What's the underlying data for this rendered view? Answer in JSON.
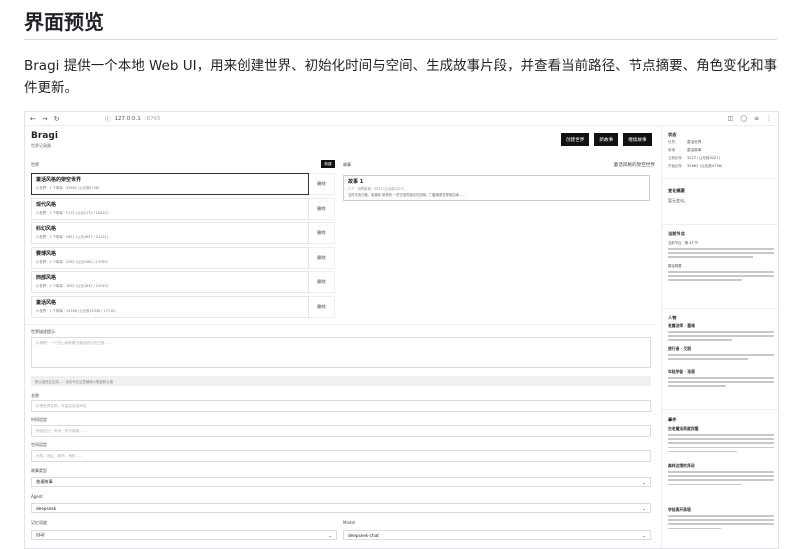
{
  "doc": {
    "title": "界面预览",
    "paragraph": "Bragi 提供一个本地 Web UI，用来创建世界、初始化时间与空间、生成故事片段，并查看当前路径、节点摘要、角色变化和事件更新。"
  },
  "browser": {
    "url": "127.0.0.1",
    "port": ":8765",
    "nav": [
      "←",
      "→",
      "↻"
    ],
    "right_icons": [
      "◫",
      "◯",
      "≡",
      "⋮"
    ]
  },
  "app": {
    "title": "Bragi",
    "subtitle": "世界记录器",
    "buttons": [
      "创建世界",
      "新故事",
      "继续故事"
    ]
  },
  "worlds": {
    "label": "世界",
    "new_label": "新建",
    "delete_label": "删除",
    "items": [
      {
        "name": "童话风格的架空世界",
        "meta": "小世界 · 1 个故事 · 32662 (公元前4756)"
      },
      {
        "name": "现代风格",
        "meta": "小世界 · 1 个故事 · 2172 (公元2172 / 18220)"
      },
      {
        "name": "科幻风格",
        "meta": "小世界 · 1 个故事 · 2657 (公元2657 / 24122)"
      },
      {
        "name": "赛博风格",
        "meta": "小世界 · 1 个故事 · 2062 (公元2062 / 13759)"
      },
      {
        "name": "西部风格",
        "meta": "小世界 · 1 个故事 · 1832 (公元1832 / 24743)"
      },
      {
        "name": "童话风格",
        "meta": "小世界 · 1 个故事 · 15336 (公元前15336 / 17710)"
      }
    ]
  },
  "story": {
    "label": "故事",
    "world_name": "童话风格的架空世界",
    "card_title": "故事 1",
    "card_meta": "1 个 · 世界故事 · 3227 (公元前3227)",
    "card_text": "当时天色已晚，老森林 常常有 一些古老的魔法在回响。门槛像是在呼吸边缘……"
  },
  "form": {
    "prompt_label": "世界描述提示",
    "prompt_placeholder": "示例提：一个在山间有着与魔法成长的王国……",
    "note": "默认描述会生成……设定可在这里编辑以覆盖默认值",
    "name_label": "名称",
    "name_placeholder": "示例世界名称，可留空自动命名",
    "time_label": "时间设定",
    "time_placeholder": "例如纪元、年份、时代背景……",
    "space_label": "空间设定",
    "space_placeholder": "大陆、地区、城市、地形……",
    "genre_label": "故事类型",
    "genre_value": "普通故事",
    "agent_label": "Agent",
    "agent_value": "deepseek",
    "memory_label": "记忆深度",
    "memory_value": "自动",
    "model_label": "Model",
    "model_value": "deepseek-chat"
  },
  "side": {
    "status_title": "状态",
    "status": [
      {
        "k": "世界",
        "v": "童话世界"
      },
      {
        "k": "故事",
        "v": "童话故事"
      },
      {
        "k": "当前纪年",
        "v": "3227 (公元前3227)"
      },
      {
        "k": "开始纪年",
        "v": "32662 (公元前4756)"
      }
    ],
    "change_title": "变化摘要",
    "change_text": "暂无变化。",
    "node_title": "当前节点",
    "node_sub1": "当前节点 · 第 43 节",
    "node_sub2": "路径概要",
    "characters_title": "人物",
    "char1": "老魔法师 · 塞维",
    "char2": "旅行者 · 艾丽",
    "char3": "年轻学徒 · 洛恩",
    "events_title": "事件",
    "event1": "古老魔法再度苏醒",
    "event2": "森林边境的异动",
    "event3": "学徒离开高塔"
  }
}
